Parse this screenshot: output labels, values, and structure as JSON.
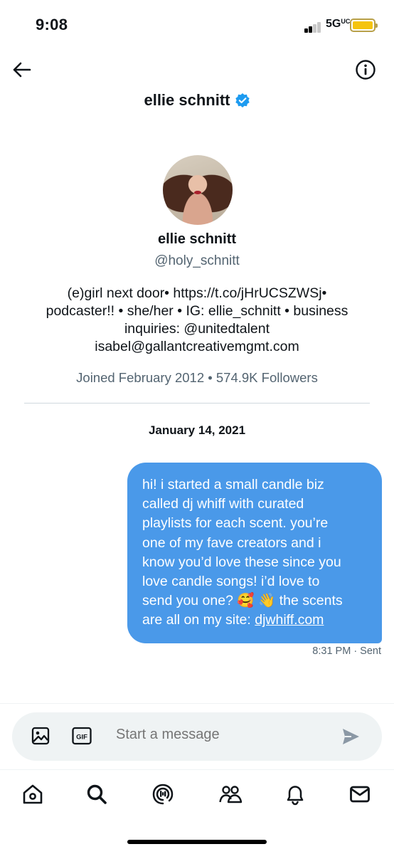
{
  "status_bar": {
    "time": "9:08",
    "network": "5G",
    "network_suffix": "UC"
  },
  "header": {
    "title": "ellie schnitt",
    "verified": true
  },
  "profile": {
    "name": "ellie schnitt",
    "handle": "@holy_schnitt",
    "bio_lines": [
      "(e)girl next door• https://t.co/jHrUCSZWSj•",
      "podcaster!! • she/her • IG: ellie_schnitt • business",
      "inquiries: @unitedtalent",
      "isabel@gallantcreativemgmt.com"
    ],
    "joined": "Joined February 2012 • 574.9K Followers"
  },
  "conversation": {
    "date": "January 14, 2021",
    "message": {
      "lines": [
        "hi! i started a small candle biz",
        "called dj whiff with curated",
        "playlists for each scent. you’re",
        "one of my fave creators and i",
        "know you’d love these since you",
        "love candle songs! i’d love to",
        "send you one? 🥰 👋 the scents",
        "are all on my site: "
      ],
      "link": "djwhiff.com",
      "time": "8:31 PM",
      "status": "· Sent"
    }
  },
  "composer": {
    "placeholder": "Start a message",
    "gif_label": "GIF"
  },
  "nav": {
    "items": [
      "home",
      "search",
      "spaces",
      "communities",
      "notifications",
      "messages"
    ]
  },
  "colors": {
    "accent": "#1d9bf0",
    "bubble": "#4a99e9",
    "secondary_text": "#536471"
  }
}
